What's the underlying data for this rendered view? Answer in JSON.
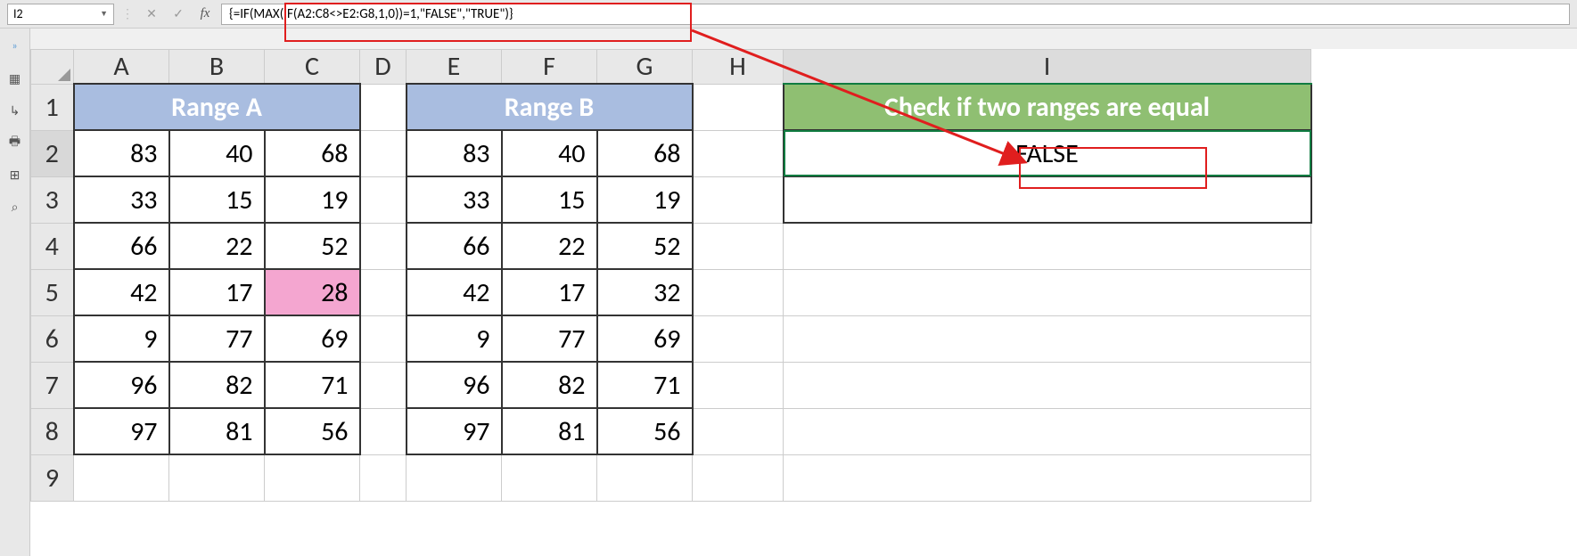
{
  "namebox": "I2",
  "formula": "{=IF(MAX(IF(A2:C8<>E2:G8,1,0))=1,\"FALSE\",\"TRUE\")}",
  "cols": [
    "A",
    "B",
    "C",
    "D",
    "E",
    "F",
    "G",
    "H",
    "I"
  ],
  "rows": [
    "1",
    "2",
    "3",
    "4",
    "5",
    "6",
    "7",
    "8",
    "9"
  ],
  "header_a": "Range A",
  "header_b": "Range B",
  "header_i": "Check if two ranges are equal",
  "result": "FALSE",
  "rangeA": [
    [
      83,
      40,
      68
    ],
    [
      33,
      15,
      19
    ],
    [
      66,
      22,
      52
    ],
    [
      42,
      17,
      28
    ],
    [
      9,
      77,
      69
    ],
    [
      96,
      82,
      71
    ],
    [
      97,
      81,
      56
    ]
  ],
  "rangeB": [
    [
      83,
      40,
      68
    ],
    [
      33,
      15,
      19
    ],
    [
      66,
      22,
      52
    ],
    [
      42,
      17,
      32
    ],
    [
      9,
      77,
      69
    ],
    [
      96,
      82,
      71
    ],
    [
      97,
      81,
      56
    ]
  ],
  "highlight_cell": "C5",
  "icons": {
    "expand": "»",
    "cancel": "✕",
    "enter": "✓",
    "fx": "fx"
  }
}
